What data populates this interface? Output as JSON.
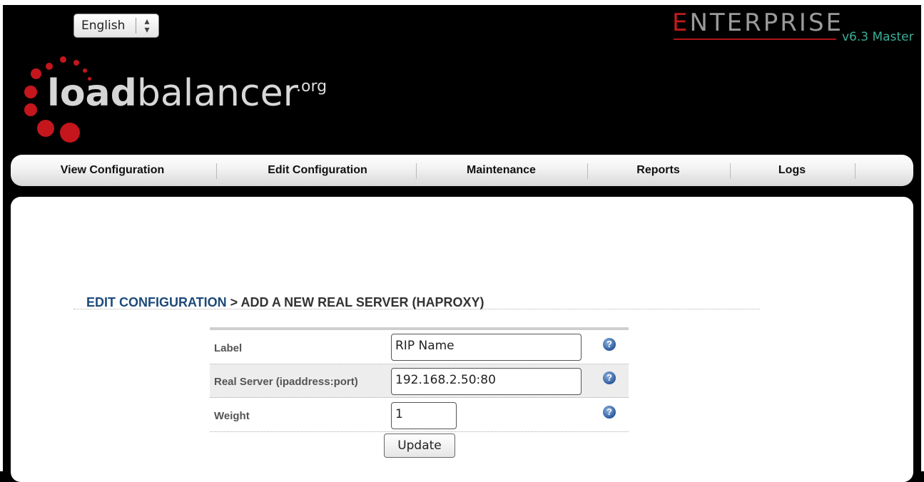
{
  "language": {
    "selected": "English"
  },
  "brand": {
    "edition": "NTERPRISE",
    "edition_initial": "E",
    "version": "v6.3 Master",
    "logo_bold": "load",
    "logo_rest": "balancer",
    "logo_suffix": ".org"
  },
  "nav": {
    "items": [
      {
        "label": "View Configuration"
      },
      {
        "label": "Edit Configuration"
      },
      {
        "label": "Maintenance"
      },
      {
        "label": "Reports"
      },
      {
        "label": "Logs"
      }
    ]
  },
  "page": {
    "crumb": "EDIT CONFIGURATION",
    "separator": " > ",
    "title": "ADD A NEW REAL SERVER (HAPROXY)"
  },
  "form": {
    "label": {
      "title": "Label",
      "value": "RIP Name"
    },
    "real_server": {
      "title": "Real Server (ipaddress:port)",
      "value": "192.168.2.50:80"
    },
    "weight": {
      "title": "Weight",
      "value": "1"
    },
    "help_glyph": "?",
    "submit": "Update"
  },
  "colors": {
    "accent_red": "#c01b1b",
    "version_teal": "#3cae98",
    "crumb_blue": "#1d4a78"
  }
}
